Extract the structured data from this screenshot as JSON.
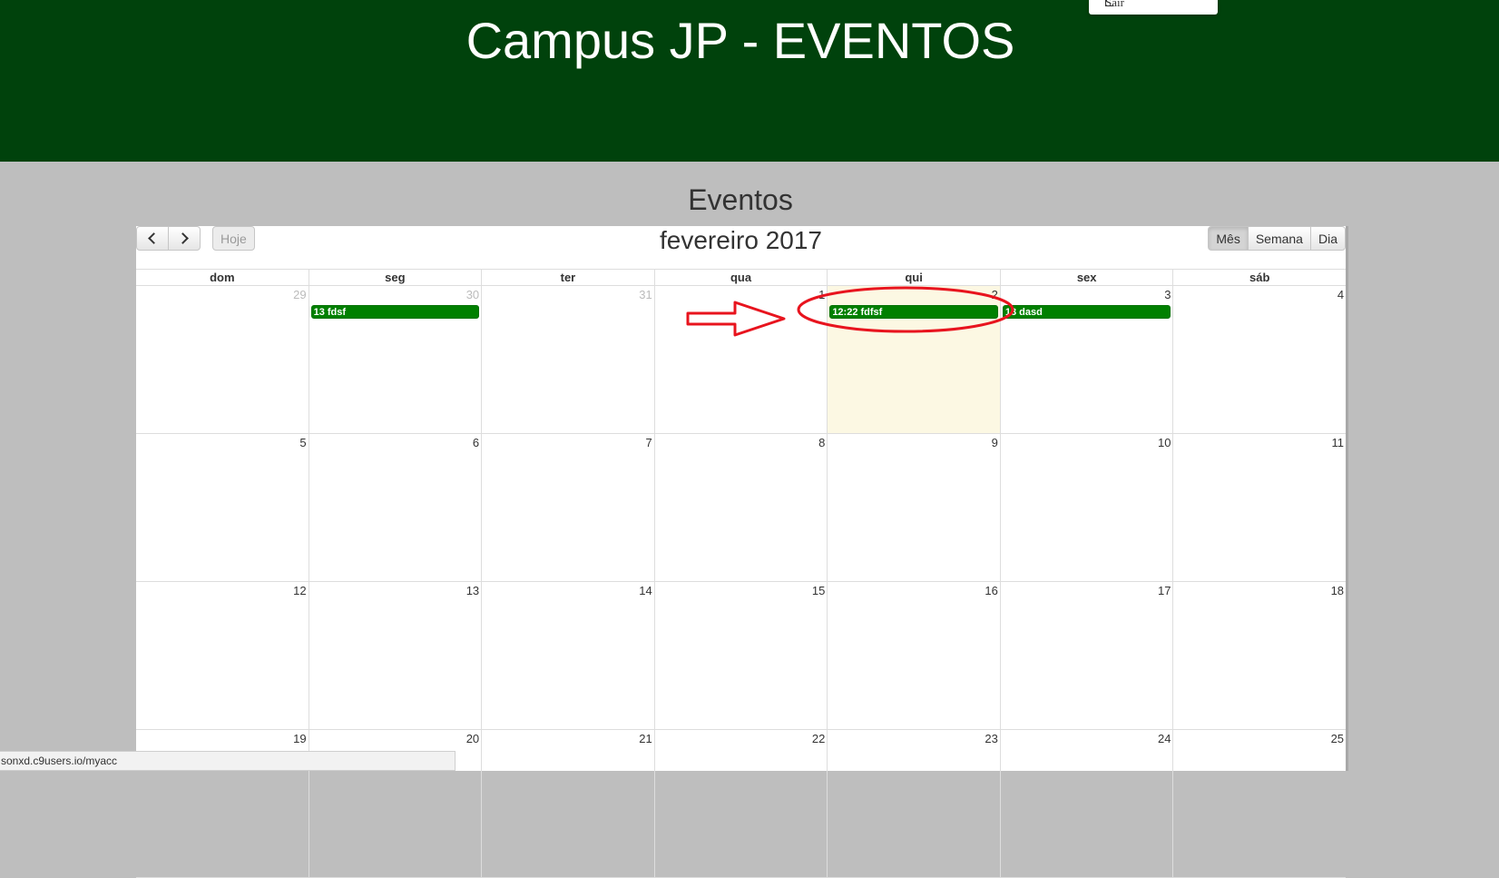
{
  "header": {
    "title": "Campus JP - EVENTOS"
  },
  "user_menu": {
    "logout_label": "Sair",
    "icon": "logout-icon"
  },
  "section": {
    "title": "Eventos"
  },
  "calendar": {
    "title": "fevereiro 2017",
    "today_label": "Hoje",
    "prev_icon": "chevron-left-icon",
    "next_icon": "chevron-right-icon",
    "views": [
      "Mês",
      "Semana",
      "Dia"
    ],
    "active_view": "Mês",
    "weekdays": [
      "dom",
      "seg",
      "ter",
      "qua",
      "qui",
      "sex",
      "sáb"
    ],
    "weeks": [
      [
        "29",
        "30",
        "31",
        "1",
        "2",
        "3",
        "4"
      ],
      [
        "5",
        "6",
        "7",
        "8",
        "9",
        "10",
        "11"
      ],
      [
        "12",
        "13",
        "14",
        "15",
        "16",
        "17",
        "18"
      ],
      [
        "19",
        "20",
        "21",
        "22",
        "23",
        "24",
        "25"
      ]
    ],
    "events": [
      {
        "label": "13 fdsf"
      },
      {
        "label": "12:22 fdfsf"
      },
      {
        "label": "13 dasd"
      }
    ],
    "today_color": "#fcf8e3",
    "event_color": "#008000"
  },
  "status_bar": {
    "url": "sonxd.c9users.io/myacc"
  },
  "colors": {
    "header_bg": "#00420c",
    "page_bg": "#bebebe",
    "annotation": "#e8141e"
  }
}
